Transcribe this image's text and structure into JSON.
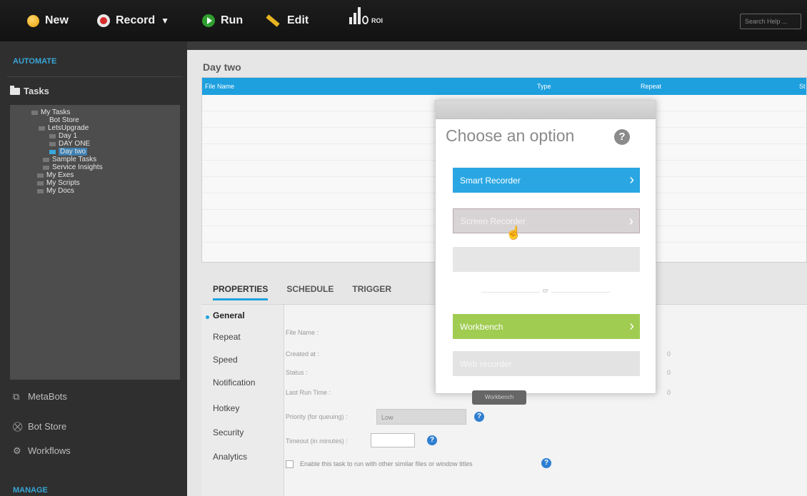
{
  "toolbar": {
    "new_label": "New",
    "record_label": "Record",
    "run_label": "Run",
    "edit_label": "Edit",
    "roi_label": "ROI",
    "search_placeholder": "Search Help ..."
  },
  "sidebar": {
    "automate_heading": "AUTOMATE",
    "tasks_label": "Tasks",
    "tree": [
      "My Tasks",
      "Bot Store",
      "LetsUpgrade",
      "Day 1",
      "DAY ONE",
      "Day two",
      "Sample Tasks",
      "Service Insights",
      "My Exes",
      "My Scripts",
      "My Docs"
    ],
    "metabots_label": "MetaBots",
    "botstore_label": "Bot Store",
    "workflows_label": "Workflows",
    "manage_heading": "MANAGE"
  },
  "main": {
    "title": "Day two",
    "columns": [
      "File Name",
      "Type",
      "Repeat",
      "St"
    ]
  },
  "properties": {
    "tabs": [
      "PROPERTIES",
      "SCHEDULE",
      "TRIGGER"
    ],
    "side_items": [
      "General",
      "Repeat",
      "Speed",
      "Notification",
      "Hotkey",
      "Security",
      "Analytics"
    ],
    "fields": {
      "file_name": "File Name :",
      "created_at": "Created at :",
      "status": "Status :",
      "last_run": "Last Run Time :",
      "priority": "Priority (for queuing) :",
      "priority_value": "Low",
      "timeout": "Timeout (in minutes) :",
      "values": [
        "0",
        "0",
        "0"
      ],
      "checkbox_label": "Enable this task to run with other similar files or window titles"
    }
  },
  "dialog": {
    "title": "Choose an option",
    "options": [
      "Smart Recorder",
      "Screen Recorder",
      "",
      "Workbench",
      "Web recorder"
    ],
    "or_label": "or",
    "tooltip": "Workbench"
  }
}
